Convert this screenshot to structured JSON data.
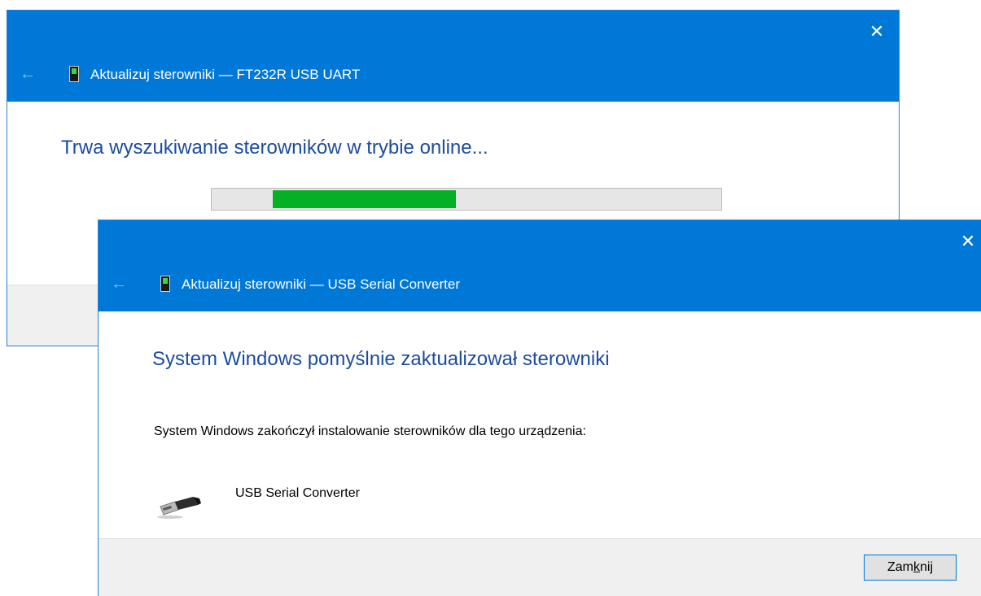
{
  "colors": {
    "accent": "#0078d7",
    "heading": "#1b4c9e",
    "progress_fill": "#06b025"
  },
  "back_dialog": {
    "title": "Aktualizuj sterowniki — FT232R USB UART",
    "close_glyph": "✕",
    "back_glyph": "←",
    "title_icon": "device-icon",
    "heading": "Trwa wyszukiwanie sterowników w trybie online...",
    "progress": {
      "value": 0.36,
      "start": 0.12
    }
  },
  "front_dialog": {
    "title": "Aktualizuj sterowniki — USB Serial Converter",
    "close_glyph": "✕",
    "back_glyph": "←",
    "title_icon": "device-icon",
    "heading": "System Windows pomyślnie zaktualizował sterowniki",
    "message": "System Windows zakończył instalowanie sterowników dla tego urządzenia:",
    "device": {
      "icon": "usb-plug-icon",
      "name": "USB Serial Converter"
    },
    "close_button": {
      "before": "Zam",
      "mnemonic": "k",
      "after": "nij"
    }
  }
}
